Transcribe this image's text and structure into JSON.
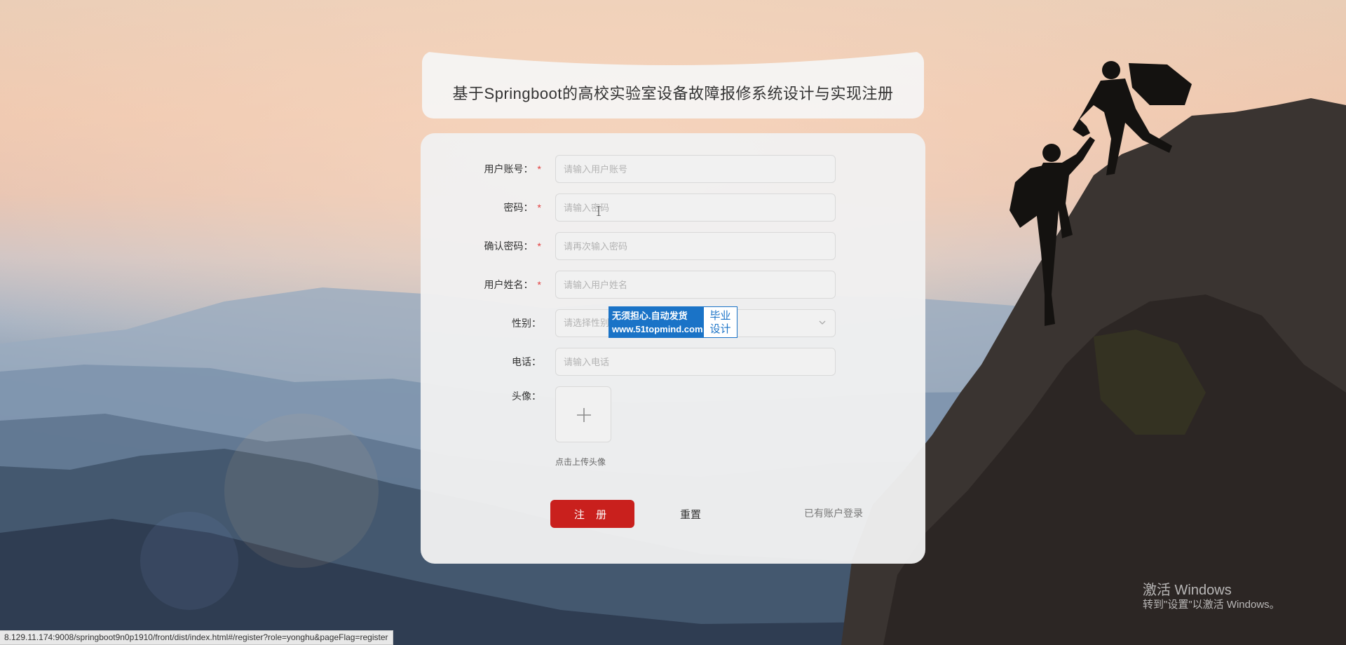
{
  "title": "基于Springboot的高校实验室设备故障报修系统设计与实现注册",
  "form": {
    "fields": [
      {
        "label": "用户账号：",
        "required": "*",
        "placeholder": "请输入用户账号"
      },
      {
        "label": "密码：",
        "required": "*",
        "placeholder": "请输入密码"
      },
      {
        "label": "确认密码：",
        "required": "*",
        "placeholder": "请再次输入密码"
      },
      {
        "label": "用户姓名：",
        "required": "*",
        "placeholder": "请输入用户姓名"
      }
    ],
    "gender": {
      "label": "性别：",
      "placeholder": "请选择性别"
    },
    "phone": {
      "label": "电话：",
      "placeholder": "请输入电话"
    },
    "avatar": {
      "label": "头像：",
      "hint": "点击上传头像"
    },
    "register_label": "注 册",
    "reset_label": "重置",
    "login_link": "已有账户登录"
  },
  "ad": {
    "line1": "无须担心.自动发货",
    "line2": "www.51topmind.com",
    "right1": "毕业",
    "right2": "设计"
  },
  "windows": {
    "line1": "激活 Windows",
    "line2": "转到\"设置\"以激活 Windows。"
  },
  "status_url": "8.129.11.174:9008/springboot9n0p1910/front/dist/index.html#/register?role=yonghu&pageFlag=register",
  "colors": {
    "primary_button": "#c9201d",
    "required_star": "#e23c3c",
    "ad_blue": "#1a73c7"
  },
  "icons": {
    "select_arrow": "chevron-down-icon",
    "upload": "plus-icon"
  }
}
